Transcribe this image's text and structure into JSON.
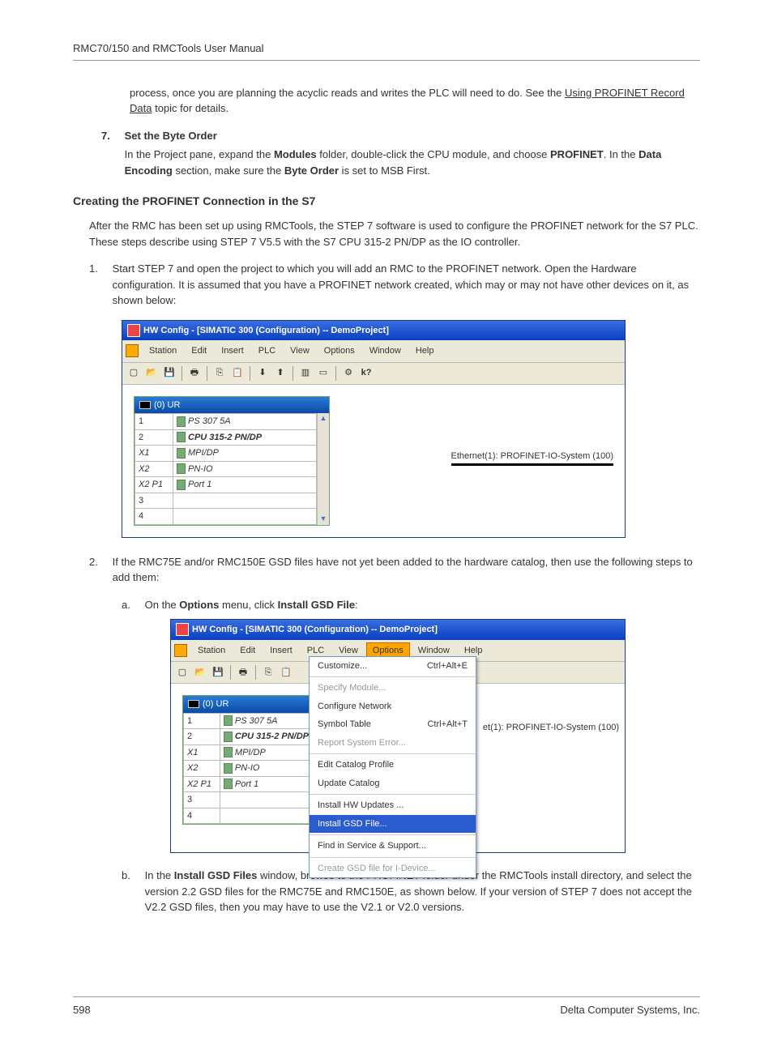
{
  "header": "RMC70/150 and RMCTools User Manual",
  "intro_tail": "process, once you are planning the acyclic reads and writes the PLC will need to do.  See the ",
  "intro_link": "Using PROFINET Record Data",
  "intro_tail2": " topic for details.",
  "step7": {
    "num": "7.",
    "title": "Set the Byte Order",
    "body1": "In the Project pane, expand the ",
    "b1": "Modules",
    "body2": " folder, double-click the CPU module, and choose ",
    "b2": "PROFINET",
    "body3": ". In the ",
    "b3": "Data Encoding",
    "body4": " section, make sure the ",
    "b4": "Byte Order",
    "body5": " is set to MSB First."
  },
  "h2": "Creating the PROFINET Connection in the S7",
  "para1": "After the RMC has been set up using RMCTools, the STEP 7 software is used to configure the PROFINET network for the S7 PLC. These steps describe using STEP 7 V5.5 with the S7 CPU 315-2 PN/DP as the IO controller.",
  "list1": {
    "num": "1.",
    "text": "Start STEP 7 and open the project to which you will add an RMC to the PROFINET network. Open the Hardware configuration. It is assumed that you have a PROFINET network created, which may or may not have other devices on it, as shown below:"
  },
  "list2": {
    "num": "2.",
    "text": "If the RMC75E and/or RMC150E GSD files have not yet been added to the hardware catalog, then use the following steps to add them:"
  },
  "sub_a": {
    "label": "a.",
    "t1": "On the ",
    "b1": "Options",
    "t2": " menu, click ",
    "b2": "Install GSD File",
    "t3": ":"
  },
  "sub_b": {
    "label": "b.",
    "t1": "In the ",
    "b1": "Install GSD Files",
    "t2": " window, browse to the PROFINET folder under the RMCTools install directory, and select the version 2.2 GSD files for the RMC75E and RMC150E, as shown below. If your version of STEP 7 does not accept the V2.2 GSD files, then you may have to use the V2.1 or V2.0 versions."
  },
  "win": {
    "title": "HW Config - [SIMATIC 300 (Configuration) -- DemoProject]",
    "menus": [
      "Station",
      "Edit",
      "Insert",
      "PLC",
      "View",
      "Options",
      "Window",
      "Help"
    ],
    "rack_title": "(0) UR",
    "rows": [
      {
        "slot": "1",
        "mod": "PS 307 5A",
        "i": false,
        "b": false,
        "ic": true
      },
      {
        "slot": "2",
        "mod": "CPU 315-2 PN/DP",
        "i": false,
        "b": true,
        "ic": true
      },
      {
        "slot": "X1",
        "mod": "MPI/DP",
        "i": true,
        "b": false,
        "ic": true
      },
      {
        "slot": "X2",
        "mod": "PN-IO",
        "i": true,
        "b": false,
        "ic": true
      },
      {
        "slot": "X2 P1",
        "mod": "Port 1",
        "i": true,
        "b": false,
        "ic": true
      },
      {
        "slot": "3",
        "mod": "",
        "i": false,
        "b": false,
        "ic": false
      },
      {
        "slot": "4",
        "mod": "",
        "i": false,
        "b": false,
        "ic": false
      }
    ],
    "eth": "Ethernet(1): PROFINET-IO-System (100)"
  },
  "win2": {
    "eth": "et(1): PROFINET-IO-System (100)",
    "options": [
      {
        "t": "Customize...",
        "sc": "Ctrl+Alt+E",
        "dis": false
      },
      {
        "sep": true
      },
      {
        "t": "Specify Module...",
        "dis": true
      },
      {
        "t": "Configure Network",
        "dis": false
      },
      {
        "t": "Symbol Table",
        "sc": "Ctrl+Alt+T",
        "dis": false
      },
      {
        "t": "Report System Error...",
        "dis": true
      },
      {
        "sep": true
      },
      {
        "t": "Edit Catalog Profile",
        "dis": false
      },
      {
        "t": "Update Catalog",
        "dis": false
      },
      {
        "sep": true
      },
      {
        "t": "Install HW Updates ...",
        "dis": false
      },
      {
        "t": "Install GSD File...",
        "dis": false,
        "sel": true
      },
      {
        "sep": true
      },
      {
        "t": "Find in Service & Support...",
        "dis": false
      },
      {
        "sep": true
      },
      {
        "t": "Create GSD file for I-Device...",
        "dis": true
      }
    ]
  },
  "footer": {
    "page": "598",
    "company": "Delta Computer Systems, Inc."
  }
}
